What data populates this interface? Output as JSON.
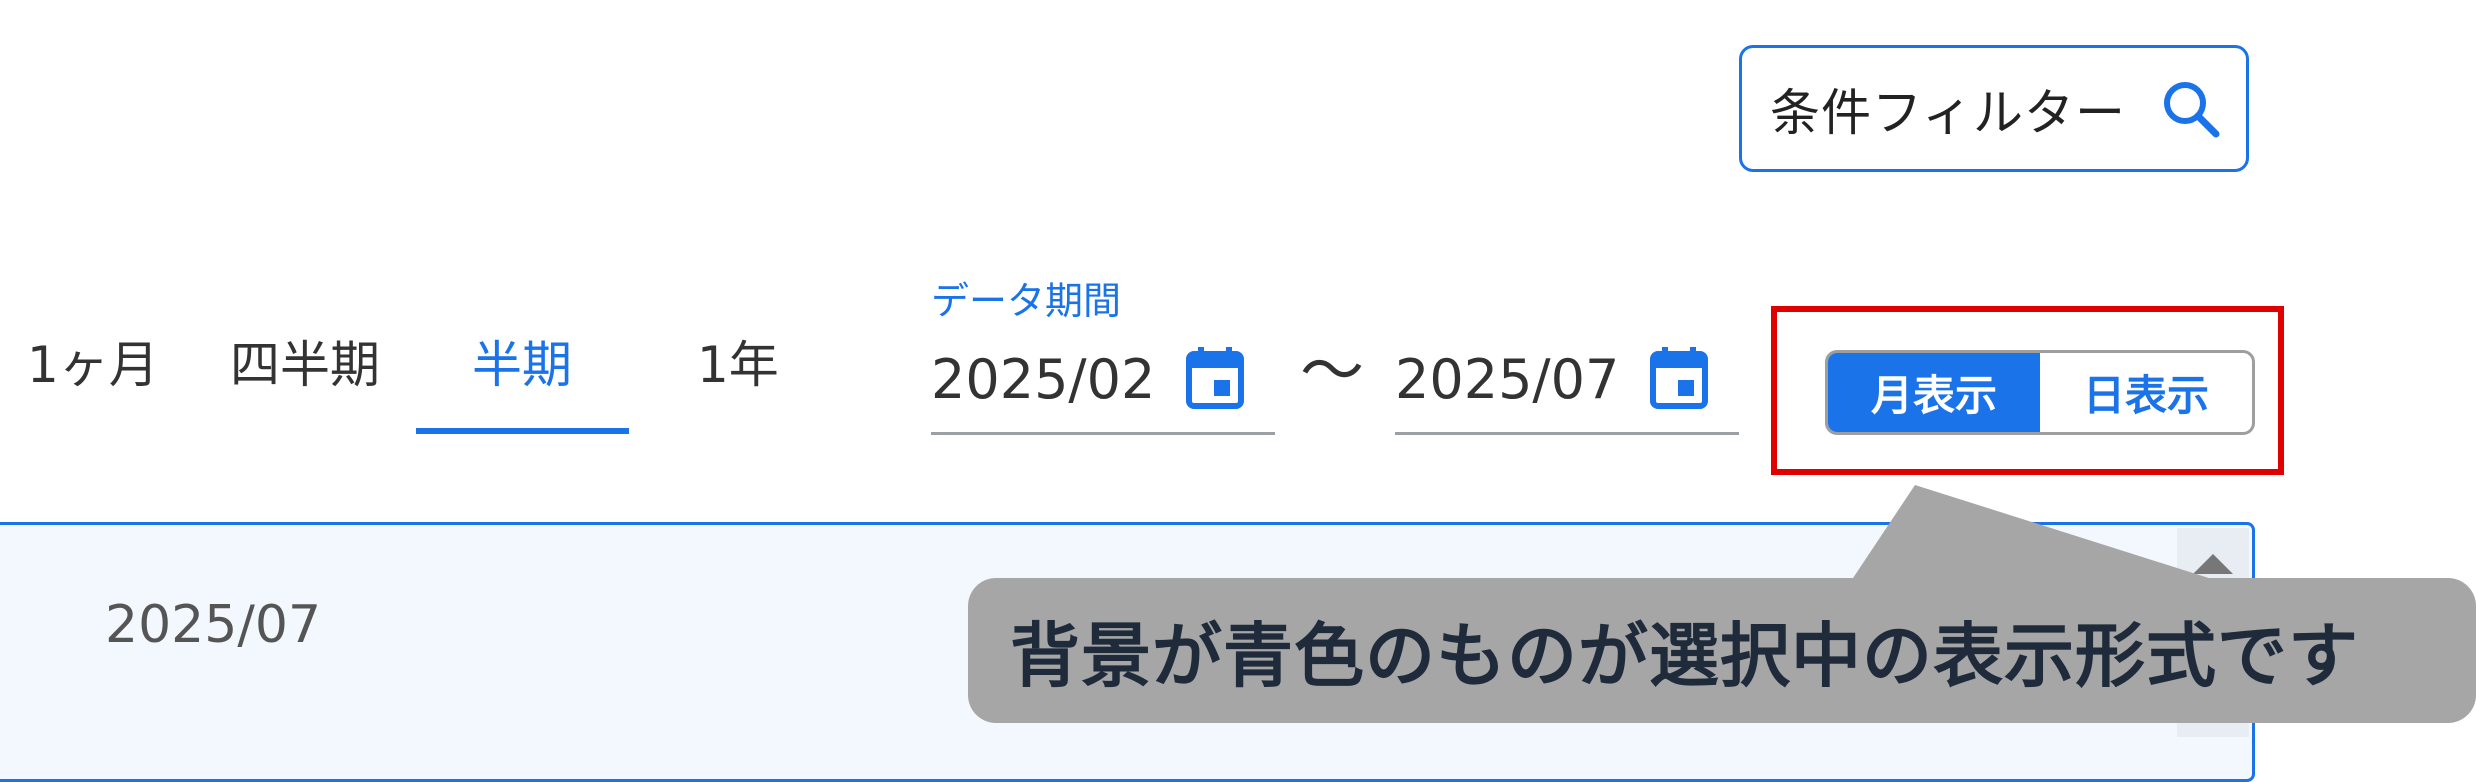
{
  "filter": {
    "label": "条件フィルター",
    "icon": "search-icon"
  },
  "period_tabs": {
    "items": [
      {
        "label": "1ヶ月",
        "active": false
      },
      {
        "label": "四半期",
        "active": false
      },
      {
        "label": "半期",
        "active": true
      },
      {
        "label": "1年",
        "active": false
      }
    ]
  },
  "date_range": {
    "label": "データ期間",
    "start": "2025/02",
    "separator": "〜",
    "end": "2025/07",
    "icon": "calendar-icon"
  },
  "view_toggle": {
    "options": [
      {
        "label": "月表示",
        "selected": true
      },
      {
        "label": "日表示",
        "selected": false
      }
    ]
  },
  "panel": {
    "row_date": "2025/07"
  },
  "callout": {
    "text": "背景が青色のものが選択中の表示形式です"
  },
  "colors": {
    "accent": "#1a73e8",
    "highlight": "#e00000",
    "callout_bg": "#a6a6a6"
  }
}
